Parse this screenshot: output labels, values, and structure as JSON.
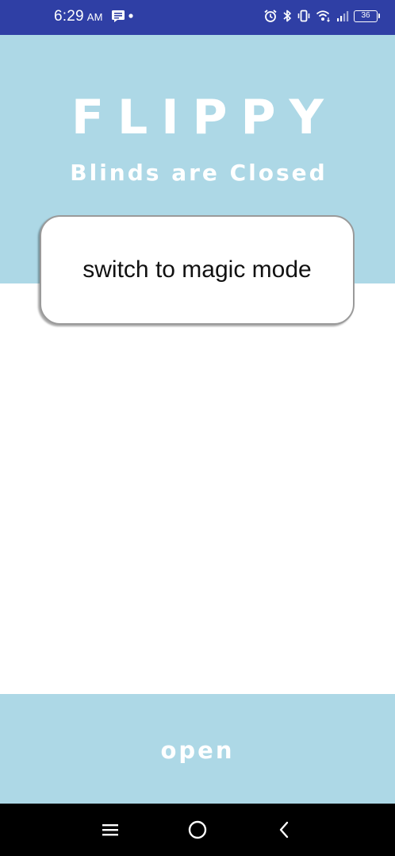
{
  "status_bar": {
    "time": "6:29",
    "ampm": "AM",
    "battery_level": "36",
    "background_color": "#2f3fa5",
    "left_icons": [
      "notification-icon",
      "dot-icon"
    ],
    "right_icons": [
      "alarm-icon",
      "bluetooth-icon",
      "vibrate-icon",
      "wifi-icon",
      "signal-icon",
      "battery-icon"
    ]
  },
  "header": {
    "title": "FLIPPY",
    "status": "Blinds are Closed",
    "background_color": "#add8e6"
  },
  "mode_button": {
    "label": "switch to magic mode"
  },
  "footer": {
    "action_label": "open",
    "background_color": "#add8e6"
  },
  "nav_bar": {
    "buttons": [
      "menu-icon",
      "home-icon",
      "back-icon"
    ]
  }
}
